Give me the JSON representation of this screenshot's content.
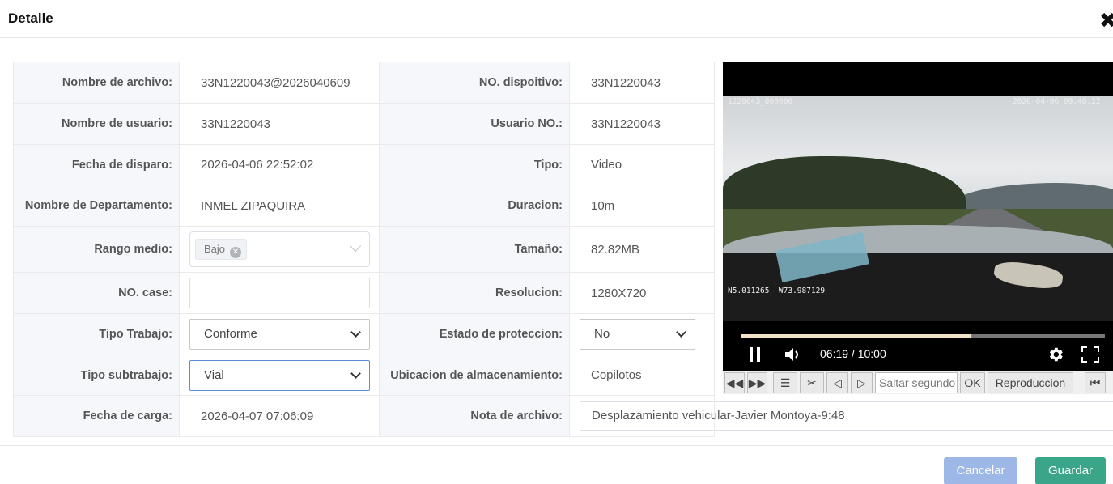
{
  "dialog": {
    "title": "Detalle",
    "close_glyph": "✖"
  },
  "fields": {
    "file_name": {
      "label": "Nombre de archivo:",
      "value": "33N1220043@2026040609"
    },
    "device_no": {
      "label": "NO. dispoitivo:",
      "value": "33N1220043"
    },
    "user_name": {
      "label": "Nombre de usuario:",
      "value": "33N1220043"
    },
    "user_no": {
      "label": "Usuario NO.:",
      "value": "33N1220043"
    },
    "trigger_date": {
      "label": "Fecha de disparo:",
      "value": "2026-04-06 22:52:02"
    },
    "type": {
      "label": "Tipo:",
      "value": "Video"
    },
    "department": {
      "label": "Nombre de Departamento:",
      "value": "INMEL ZIPAQUIRA"
    },
    "duration": {
      "label": "Duracion:",
      "value": "10m"
    },
    "mid_range": {
      "label": "Rango medio:",
      "tag": "Bajo"
    },
    "size": {
      "label": "Tamaño:",
      "value": "82.82MB"
    },
    "case_no": {
      "label": "NO. case:",
      "value": ""
    },
    "resolution": {
      "label": "Resolucion:",
      "value": "1280X720"
    },
    "work_type": {
      "label": "Tipo Trabajo:",
      "value": "Conforme"
    },
    "protection_state": {
      "label": "Estado de proteccion:",
      "value": "No"
    },
    "subwork_type": {
      "label": "Tipo subtrabajo:",
      "value": "Vial"
    },
    "storage_location": {
      "label": "Ubicacion de almacenamiento:",
      "value": "Copilotos"
    },
    "upload_date": {
      "label": "Fecha de carga:",
      "value": "2026-04-07 07:06:09"
    },
    "file_note": {
      "label": "Nota de archivo:",
      "value": "Desplazamiento vehicular-Javier Montoya-9:48"
    }
  },
  "player": {
    "osd_top_left": "1220043_000000",
    "osd_top_right": "2026-04-06 09:48:22",
    "osd_bottom_left": "N5.011265  W73.987129",
    "time": "06:19 / 10:00",
    "progress_fraction": 0.632,
    "toolbar": {
      "seek_placeholder": "Saltar segundo",
      "ok_label": "OK",
      "playback_label": "Reproduccion"
    }
  },
  "footer": {
    "cancel_label": "Cancelar",
    "save_label": "Guardar"
  },
  "colors": {
    "cancel": "#9db7e6",
    "save": "#3aa588",
    "label_bg": "#f5f7fa"
  }
}
